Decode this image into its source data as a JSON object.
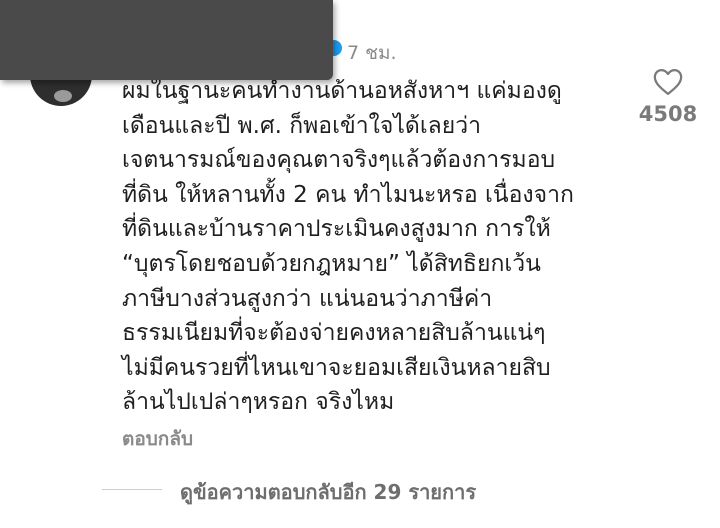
{
  "comment": {
    "time_ago": "7 ชม.",
    "lines": [
      "ผมในฐานะคนทำงานด้านอหสังหาฯ แค่มองดู",
      "เดือนและปี พ.ศ. ก็พอเข้าใจได้เลยว่า",
      "เจตนารมณ์ของคุณตาจริงๆแล้วต้องการมอบ",
      "ที่ดิน ให้หลานทั้ง 2 คน ทำไมนะหรอ  เนื่องจาก",
      "ที่ดินและบ้านราคาประเมินคงสูงมาก การให้",
      "“บุตรโดยชอบด้วยกฎหมาย”  ได้สิทธิยกเว้น",
      "ภาษีบางส่วนสูงกว่า แน่นอนว่าภาษีค่า",
      "ธรรมเนียมที่จะต้องจ่ายคงหลายสิบล้านแน่ๆ",
      "ไม่มีคนรวยที่ไหนเขาจะยอมเสียเงินหลายสิบ",
      "ล้านไปเปล่าๆหรอก จริงไหม"
    ],
    "like_count": "4508",
    "reply_label": "ตอบกลับ",
    "view_replies_label": "ดูข้อความตอบกลับอีก 29 รายการ"
  },
  "colors": {
    "text": "#1f1f1f",
    "muted": "#8a8a8a",
    "verified": "#1d9bf0",
    "occluder": "#4a4a4a"
  },
  "icons": {
    "like": "heart-outline-icon",
    "verified": "verified-badge-icon"
  }
}
